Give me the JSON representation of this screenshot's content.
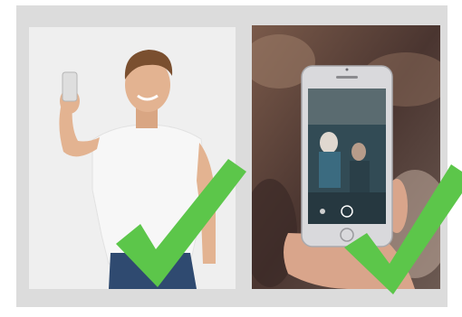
{
  "colors": {
    "panel_background": "#dcdcdc",
    "checkmark": "#5cc64a",
    "left_photo_background": "#efefef",
    "shirt": "#f7f7f7",
    "skin": "#e3b391",
    "hair": "#7a4f2f",
    "jeans": "#2f4a70",
    "right_photo_background": "#5a4034",
    "phone_frame": "#d9d9dc",
    "phone_screen": "#324b55"
  },
  "icons": {
    "left_check": "checkmark-icon",
    "right_check": "checkmark-icon"
  },
  "images": {
    "left": "man-taking-selfie-photo",
    "right": "hand-holding-smartphone-photo"
  }
}
